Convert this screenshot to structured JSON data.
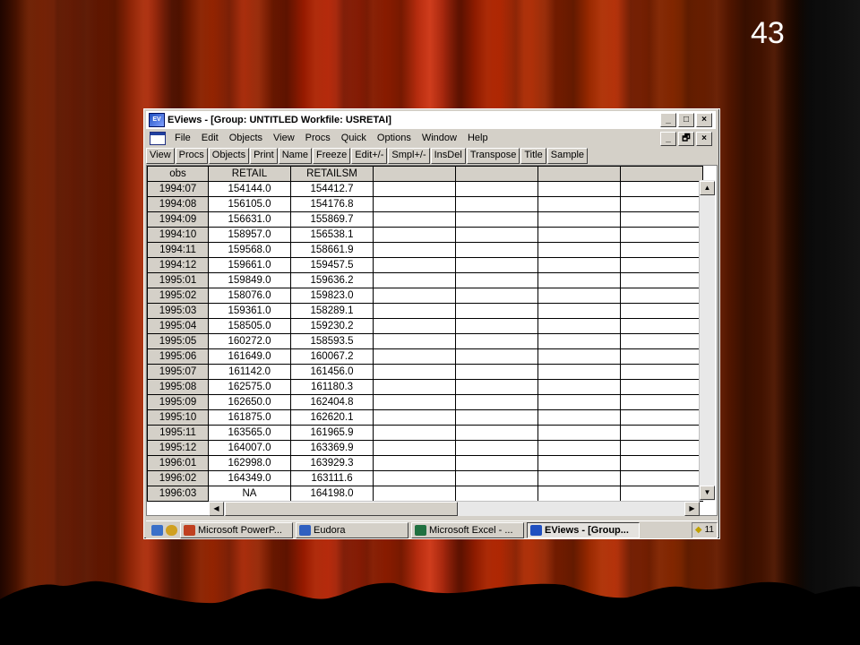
{
  "slide": {
    "number": "43"
  },
  "window": {
    "title": "EViews - [Group: UNTITLED   Workfile: USRETAI]",
    "caption_buttons": [
      "_",
      "□",
      "×"
    ],
    "mdi_buttons": [
      "_",
      "🗗",
      "×"
    ]
  },
  "menu": [
    "File",
    "Edit",
    "Objects",
    "View",
    "Procs",
    "Quick",
    "Options",
    "Window",
    "Help"
  ],
  "toolbar": [
    "View",
    "Procs",
    "Objects",
    "Print",
    "Name",
    "Freeze",
    "Edit+/-",
    "Smpl+/-",
    "InsDel",
    "Transpose",
    "Title",
    "Sample"
  ],
  "grid": {
    "headers": [
      "obs",
      "RETAIL",
      "RETAILSM",
      "",
      "",
      "",
      ""
    ],
    "rows": [
      [
        "1994:07",
        "154144.0",
        "154412.7"
      ],
      [
        "1994:08",
        "156105.0",
        "154176.8"
      ],
      [
        "1994:09",
        "156631.0",
        "155869.7"
      ],
      [
        "1994:10",
        "158957.0",
        "156538.1"
      ],
      [
        "1994:11",
        "159568.0",
        "158661.9"
      ],
      [
        "1994:12",
        "159661.0",
        "159457.5"
      ],
      [
        "1995:01",
        "159849.0",
        "159636.2"
      ],
      [
        "1995:02",
        "158076.0",
        "159823.0"
      ],
      [
        "1995:03",
        "159361.0",
        "158289.1"
      ],
      [
        "1995:04",
        "158505.0",
        "159230.2"
      ],
      [
        "1995:05",
        "160272.0",
        "158593.5"
      ],
      [
        "1995:06",
        "161649.0",
        "160067.2"
      ],
      [
        "1995:07",
        "161142.0",
        "161456.0"
      ],
      [
        "1995:08",
        "162575.0",
        "161180.3"
      ],
      [
        "1995:09",
        "162650.0",
        "162404.8"
      ],
      [
        "1995:10",
        "161875.0",
        "162620.1"
      ],
      [
        "1995:11",
        "163565.0",
        "161965.9"
      ],
      [
        "1995:12",
        "164007.0",
        "163369.9"
      ],
      [
        "1996:01",
        "162998.0",
        "163929.3"
      ],
      [
        "1996:02",
        "164349.0",
        "163111.6"
      ],
      [
        "1996:03",
        "NA",
        "164198.0"
      ]
    ]
  },
  "taskbar": {
    "tasks": [
      {
        "label": "Microsoft PowerP...",
        "icon": "powerpoint-icon",
        "color": "#c04020",
        "active": false
      },
      {
        "label": "Eudora",
        "icon": "eudora-icon",
        "color": "#3060c0",
        "active": false
      },
      {
        "label": "Microsoft Excel - ...",
        "icon": "excel-icon",
        "color": "#207040",
        "active": false
      },
      {
        "label": "EViews - [Group...",
        "icon": "eviews-icon",
        "color": "#2050c0",
        "active": true
      }
    ],
    "clock": "11"
  }
}
